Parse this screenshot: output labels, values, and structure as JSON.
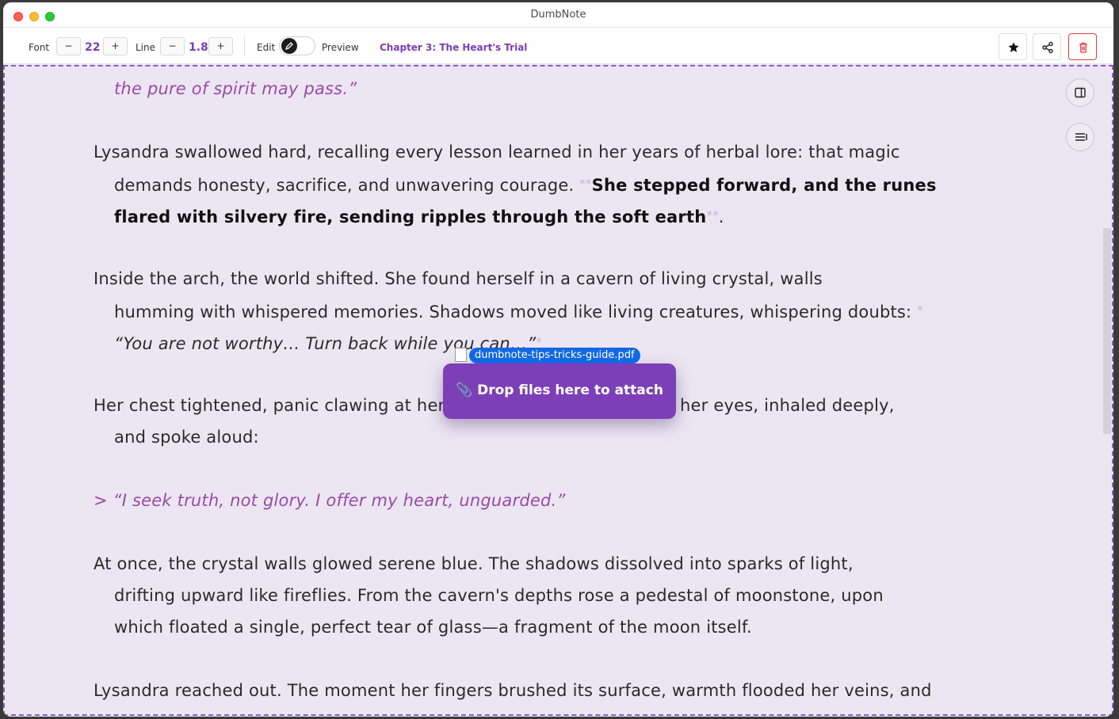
{
  "window": {
    "title": "DumbNote"
  },
  "toolbar": {
    "font_label": "Font",
    "font_decrease": "−",
    "font_value": "22",
    "font_increase": "+",
    "line_label": "Line",
    "line_decrease": "−",
    "line_value": "1.8",
    "line_increase": "+",
    "edit_label": "Edit",
    "preview_label": "Preview",
    "chapter_title": "Chapter 3: The Heart's Trial",
    "icons": [
      "pin-icon",
      "share-icon",
      "trash-icon"
    ]
  },
  "content": {
    "p0_l1": "the pure of spirit may pass.”",
    "p1_l1": "Lysandra swallowed hard, recalling every lesson learned in her years of herbal lore: that magic",
    "p1_l2_a": "demands honesty, sacrifice, and unwavering courage. ",
    "p1_md_open": "**",
    "p1_l2_bold": "She stepped forward, and the runes",
    "p1_l3_bold": "flared with silvery fire, sending ripples through the soft earth",
    "p1_md_close": "**",
    "p1_l3_end": ".",
    "p2_l1": "Inside the arch, the world shifted. She found herself in a cavern of living crystal, walls",
    "p2_l2": "humming with whispered memories. Shadows moved like living creatures, whispering doubts: ",
    "p2_md_open": "*",
    "p2_l3": "“You are not worthy… Turn back while you can…”",
    "p2_md_close": "*",
    "p3_l1_a": "Her chest tightened, panic clawing at her",
    "p3_l1_b": "her eyes, inhaled deeply,",
    "p3_l2": "and spoke aloud:",
    "quote": "> “I seek truth, not glory. I offer my heart, unguarded.”",
    "p4_l1": "At once, the crystal walls glowed serene blue. The shadows dissolved into sparks of light,",
    "p4_l2": "drifting upward like fireflies. From the cavern's depths rose a pedestal of moonstone, upon",
    "p4_l3": "which floated a single, perfect tear of glass—a fragment of the moon itself.",
    "p5_l1": "Lysandra reached out. The moment her fingers brushed its surface, warmth flooded her veins, and"
  },
  "drop_overlay": {
    "label": "📎 Drop files here to attach",
    "dragged_file": "dumbnote-tips-tricks-guide.pdf"
  },
  "colors": {
    "accent": "#7c3fb7",
    "editor_bg": "#ece6f2",
    "file_chip": "#1267e2",
    "danger": "#e23b3b"
  }
}
